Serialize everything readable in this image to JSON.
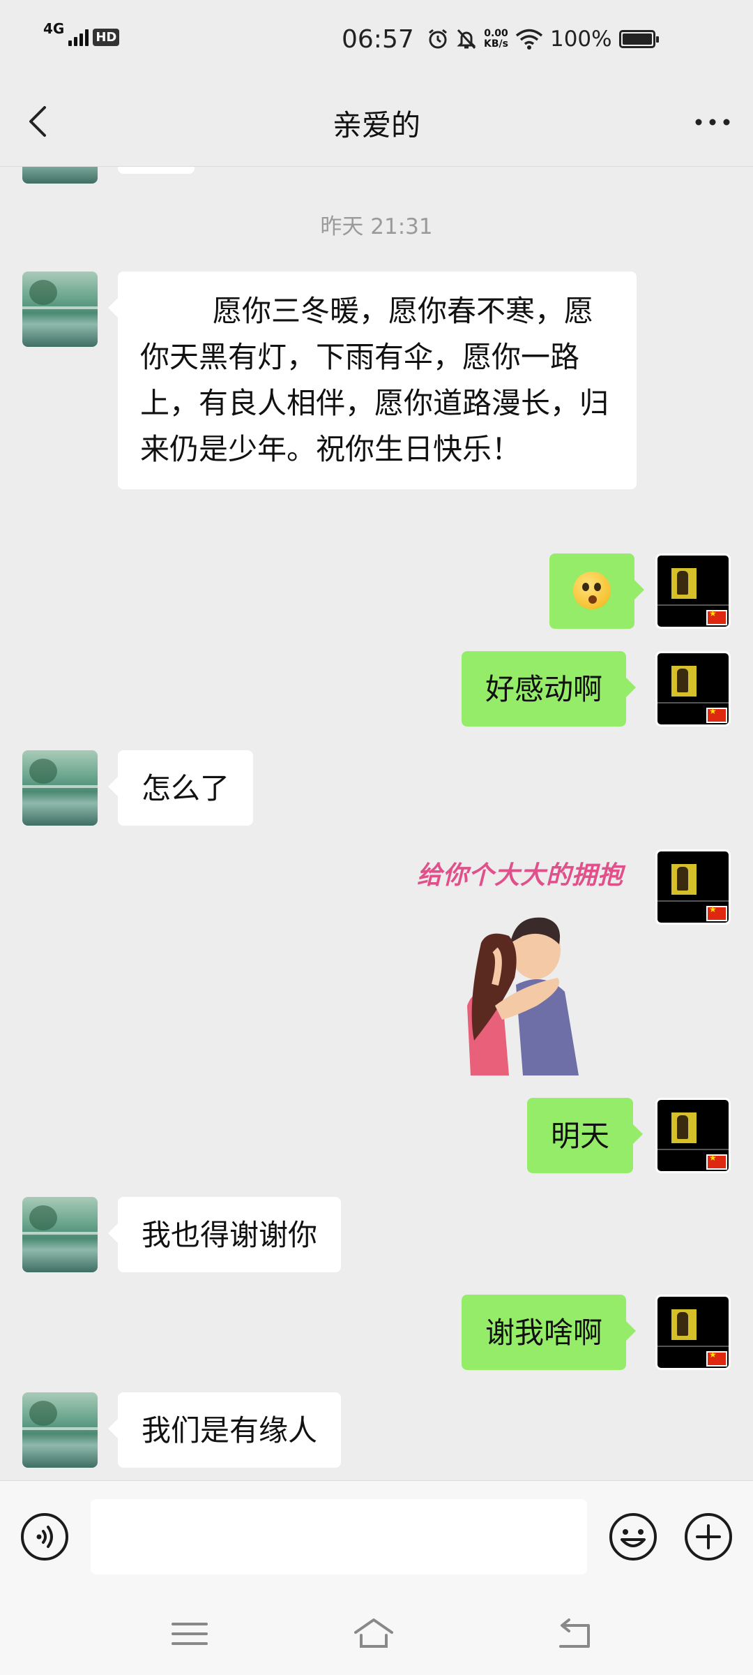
{
  "status_bar": {
    "network": "4G",
    "hd": "HD",
    "time": "06:57",
    "speed_value": "0.00",
    "speed_unit": "KB/s",
    "battery": "100%",
    "battery_level": 1.0
  },
  "header": {
    "title": "亲爱的",
    "back_icon": "chevron-left-icon",
    "more_icon": "more-dots-icon"
  },
  "chat": {
    "timestamp": "昨天 21:31",
    "messages": [
      {
        "side": "peer",
        "type": "text",
        "text": "愿你三冬暖，愿你春不寒，愿你天黑有灯，下雨有伞，愿你一路上，有良人相伴，愿你道路漫长，归来仍是少年。祝你生日快乐！"
      },
      {
        "side": "self",
        "type": "emoji",
        "emoji": "surprised-face-emoji"
      },
      {
        "side": "self",
        "type": "text",
        "text": "好感动啊"
      },
      {
        "side": "peer",
        "type": "text",
        "text": "怎么了"
      },
      {
        "side": "self",
        "type": "sticker",
        "caption": "给你个大大的拥抱"
      },
      {
        "side": "self",
        "type": "text",
        "text": "明天"
      },
      {
        "side": "peer",
        "type": "text",
        "text": "我也得谢谢你"
      },
      {
        "side": "self",
        "type": "text",
        "text": "谢我啥啊"
      },
      {
        "side": "peer",
        "type": "text",
        "text": "我们是有缘人"
      }
    ]
  },
  "input_bar": {
    "voice_icon": "voice-icon",
    "text_value": "",
    "emoji_icon": "emoji-icon",
    "add_icon": "plus-icon"
  },
  "nav_bar": {
    "menu_icon": "menu-icon",
    "home_icon": "home-icon",
    "back_icon": "back-icon"
  },
  "colors": {
    "background": "#ededed",
    "self_bubble": "#95ec69",
    "peer_bubble": "#ffffff",
    "timestamp": "#9a9a9a"
  }
}
